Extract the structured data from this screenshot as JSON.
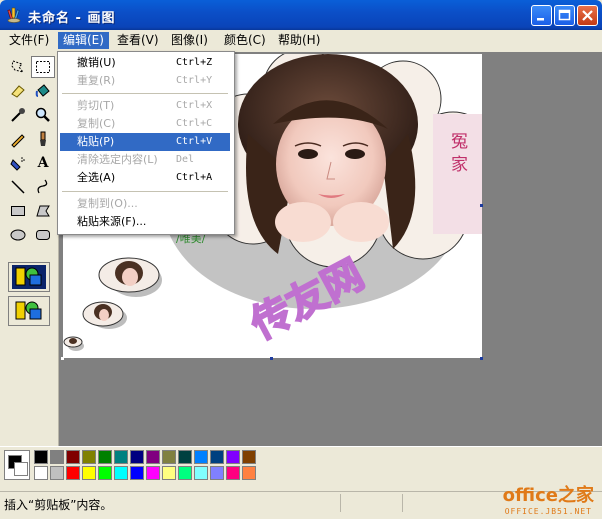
{
  "window": {
    "title": "未命名 - 画图"
  },
  "menubar": {
    "items": [
      {
        "label": "文件(F)"
      },
      {
        "label": "编辑(E)"
      },
      {
        "label": "查看(V)"
      },
      {
        "label": "图像(I)"
      },
      {
        "label": "颜色(C)"
      },
      {
        "label": "帮助(H)"
      }
    ]
  },
  "edit_menu": {
    "items": [
      {
        "label": "撤销(U)",
        "shortcut": "Ctrl+Z",
        "enabled": true
      },
      {
        "label": "重复(R)",
        "shortcut": "Ctrl+Y",
        "enabled": false
      },
      {
        "label": "剪切(T)",
        "shortcut": "Ctrl+X",
        "enabled": false
      },
      {
        "label": "复制(C)",
        "shortcut": "Ctrl+C",
        "enabled": false
      },
      {
        "label": "粘贴(P)",
        "shortcut": "Ctrl+V",
        "enabled": true,
        "highlighted": true
      },
      {
        "label": "清除选定内容(L)",
        "shortcut": "Del",
        "enabled": false
      },
      {
        "label": "全选(A)",
        "shortcut": "Ctrl+A",
        "enabled": true
      },
      {
        "label": "复制到(O)...",
        "shortcut": "",
        "enabled": false
      },
      {
        "label": "粘贴来源(F)...",
        "shortcut": "",
        "enabled": true
      }
    ]
  },
  "canvas": {
    "artwork_texts": [
      "冤",
      "家",
      "传友网"
    ]
  },
  "palette": {
    "row1": [
      "#000000",
      "#808080",
      "#800000",
      "#808000",
      "#008000",
      "#008080",
      "#000080",
      "#800080",
      "#808040",
      "#004040",
      "#0080ff",
      "#004080",
      "#8000ff",
      "#804000"
    ],
    "row2": [
      "#ffffff",
      "#c0c0c0",
      "#ff0000",
      "#ffff00",
      "#00ff00",
      "#00ffff",
      "#0000ff",
      "#ff00ff",
      "#ffff80",
      "#00ff80",
      "#80ffff",
      "#8080ff",
      "#ff0080",
      "#ff8040"
    ]
  },
  "status": {
    "text": "插入“剪贴板”内容。"
  },
  "brand": {
    "main": "office之家",
    "sub": "OFFICE.JB51.NET"
  }
}
